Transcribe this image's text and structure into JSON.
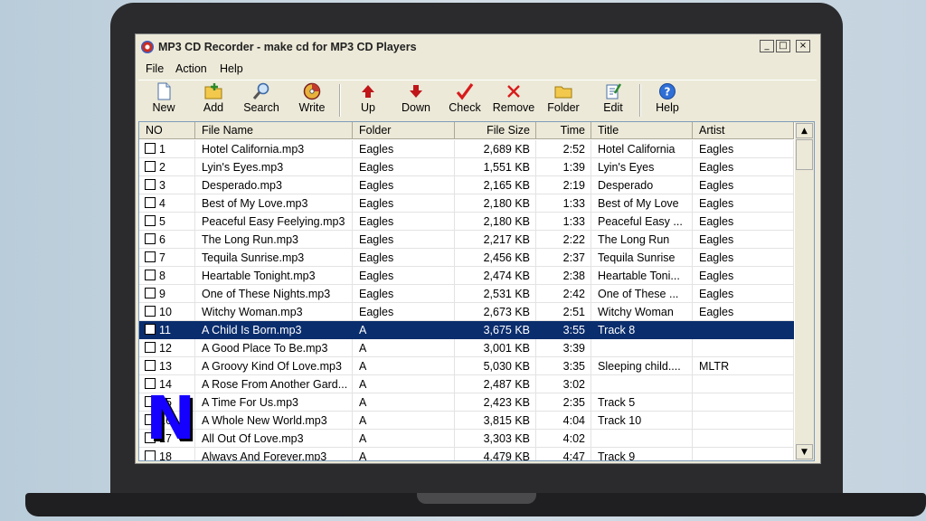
{
  "window": {
    "title": "MP3 CD Recorder - make cd for MP3 CD Players",
    "controls": {
      "minimize": "_",
      "maximize": "□",
      "close": "×"
    }
  },
  "menu": [
    "File",
    "Action",
    "Help"
  ],
  "toolbar": [
    {
      "label": "New",
      "icon": "new-document-icon"
    },
    {
      "label": "Add",
      "icon": "add-folder-icon"
    },
    {
      "label": "Search",
      "icon": "search-icon"
    },
    {
      "label": "Write",
      "icon": "write-cd-icon"
    },
    {
      "label": "Up",
      "icon": "arrow-up-icon"
    },
    {
      "label": "Down",
      "icon": "arrow-down-icon"
    },
    {
      "label": "Check",
      "icon": "check-icon"
    },
    {
      "label": "Remove",
      "icon": "remove-icon"
    },
    {
      "label": "Folder",
      "icon": "folder-icon"
    },
    {
      "label": "Edit",
      "icon": "edit-icon"
    },
    {
      "label": "Help",
      "icon": "help-icon"
    }
  ],
  "table": {
    "columns": [
      "NO",
      "File Name",
      "Folder",
      "File Size",
      "Time",
      "Title",
      "Artist"
    ],
    "selected_row": 10,
    "rows": [
      {
        "no": "1",
        "file": "Hotel California.mp3",
        "folder": "Eagles",
        "size": "2,689 KB",
        "time": "2:52",
        "title": "Hotel California",
        "artist": "Eagles"
      },
      {
        "no": "2",
        "file": "Lyin's Eyes.mp3",
        "folder": "Eagles",
        "size": "1,551 KB",
        "time": "1:39",
        "title": "Lyin's Eyes",
        "artist": "Eagles"
      },
      {
        "no": "3",
        "file": "Desperado.mp3",
        "folder": "Eagles",
        "size": "2,165 KB",
        "time": "2:19",
        "title": "Desperado",
        "artist": "Eagles"
      },
      {
        "no": "4",
        "file": "Best of My Love.mp3",
        "folder": "Eagles",
        "size": "2,180 KB",
        "time": "1:33",
        "title": "Best of My Love",
        "artist": "Eagles"
      },
      {
        "no": "5",
        "file": "Peaceful Easy Feelying.mp3",
        "folder": "Eagles",
        "size": "2,180 KB",
        "time": "1:33",
        "title": "Peaceful Easy ...",
        "artist": "Eagles"
      },
      {
        "no": "6",
        "file": "The Long Run.mp3",
        "folder": "Eagles",
        "size": "2,217 KB",
        "time": "2:22",
        "title": "The Long Run",
        "artist": "Eagles"
      },
      {
        "no": "7",
        "file": "Tequila Sunrise.mp3",
        "folder": "Eagles",
        "size": "2,456 KB",
        "time": "2:37",
        "title": "Tequila Sunrise",
        "artist": "Eagles"
      },
      {
        "no": "8",
        "file": "Heartable Tonight.mp3",
        "folder": "Eagles",
        "size": "2,474 KB",
        "time": "2:38",
        "title": "Heartable Toni...",
        "artist": "Eagles"
      },
      {
        "no": "9",
        "file": "One of These Nights.mp3",
        "folder": "Eagles",
        "size": "2,531 KB",
        "time": "2:42",
        "title": "One of These ...",
        "artist": "Eagles"
      },
      {
        "no": "10",
        "file": "Witchy Woman.mp3",
        "folder": "Eagles",
        "size": "2,673 KB",
        "time": "2:51",
        "title": "Witchy Woman",
        "artist": "Eagles"
      },
      {
        "no": "11",
        "file": "A Child Is Born.mp3",
        "folder": "A",
        "size": "3,675 KB",
        "time": "3:55",
        "title": "Track 8",
        "artist": ""
      },
      {
        "no": "12",
        "file": "A Good Place To Be.mp3",
        "folder": "A",
        "size": "3,001 KB",
        "time": "3:39",
        "title": "",
        "artist": ""
      },
      {
        "no": "13",
        "file": "A Groovy Kind Of Love.mp3",
        "folder": "A",
        "size": "5,030 KB",
        "time": "3:35",
        "title": "Sleeping child....",
        "artist": "MLTR"
      },
      {
        "no": "14",
        "file": "A Rose From Another Gard...",
        "folder": "A",
        "size": "2,487 KB",
        "time": "3:02",
        "title": "",
        "artist": ""
      },
      {
        "no": "15",
        "file": "A Time For Us.mp3",
        "folder": "A",
        "size": "2,423 KB",
        "time": "2:35",
        "title": "Track 5",
        "artist": ""
      },
      {
        "no": "16",
        "file": "A Whole New World.mp3",
        "folder": "A",
        "size": "3,815 KB",
        "time": "4:04",
        "title": "Track 10",
        "artist": ""
      },
      {
        "no": "17",
        "file": "All Out Of Love.mp3",
        "folder": "A",
        "size": "3,303 KB",
        "time": "4:02",
        "title": "",
        "artist": ""
      },
      {
        "no": "18",
        "file": "Always And Forever.mp3",
        "folder": "A",
        "size": "4,479 KB",
        "time": "4:47",
        "title": "Track 9",
        "artist": ""
      }
    ]
  },
  "scrollbar": {
    "up": "▲",
    "down": "▼"
  },
  "logo": {
    "letter": "N",
    "color": "#1500ff"
  },
  "colors": {
    "selection": "#0a2d6d",
    "chrome": "#ece9d8"
  }
}
